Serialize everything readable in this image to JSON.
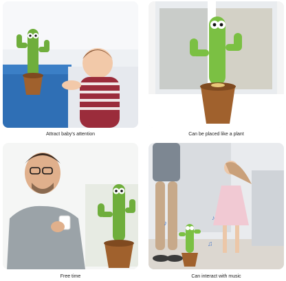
{
  "panels": [
    {
      "caption": "Attract baby's attention",
      "scene": "cactus-toy-with-baby"
    },
    {
      "caption": "Can be placed like a plant",
      "scene": "cactus-toy-by-window"
    },
    {
      "caption": "Free time",
      "scene": "man-with-coffee-and-cactus-toy"
    },
    {
      "caption": "Can interact with music",
      "scene": "dancing-family-with-cactus-toy"
    }
  ],
  "colors": {
    "cactus": "#6fae3c",
    "pot": "#a0612d",
    "background": "#ffffff"
  }
}
